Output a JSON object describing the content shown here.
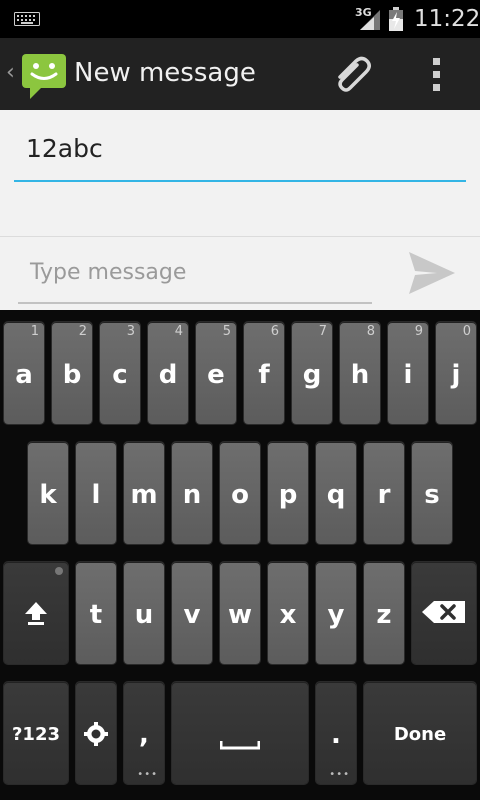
{
  "status_bar": {
    "network_label": "3G",
    "time": "11:22",
    "icons": [
      "keyboard-icon",
      "signal-icon",
      "battery-icon"
    ]
  },
  "action_bar": {
    "title": "New message",
    "icons": [
      "app-icon",
      "paperclip-icon",
      "overflow-menu-icon"
    ]
  },
  "compose": {
    "recipient_value": "12abc",
    "message_placeholder": "Type message",
    "accent_color": "#33b5e5"
  },
  "keyboard": {
    "row1": [
      {
        "label": "a",
        "hint": "1"
      },
      {
        "label": "b",
        "hint": "2"
      },
      {
        "label": "c",
        "hint": "3"
      },
      {
        "label": "d",
        "hint": "4"
      },
      {
        "label": "e",
        "hint": "5"
      },
      {
        "label": "f",
        "hint": "6"
      },
      {
        "label": "g",
        "hint": "7"
      },
      {
        "label": "h",
        "hint": "8"
      },
      {
        "label": "i",
        "hint": "9"
      },
      {
        "label": "j",
        "hint": "0"
      }
    ],
    "row2": [
      "k",
      "l",
      "m",
      "n",
      "o",
      "p",
      "q",
      "r",
      "s"
    ],
    "row3": [
      "t",
      "u",
      "v",
      "w",
      "x",
      "y",
      "z"
    ],
    "symbols_label": "?123",
    "comma_label": ",",
    "period_label": ".",
    "done_label": "Done"
  }
}
